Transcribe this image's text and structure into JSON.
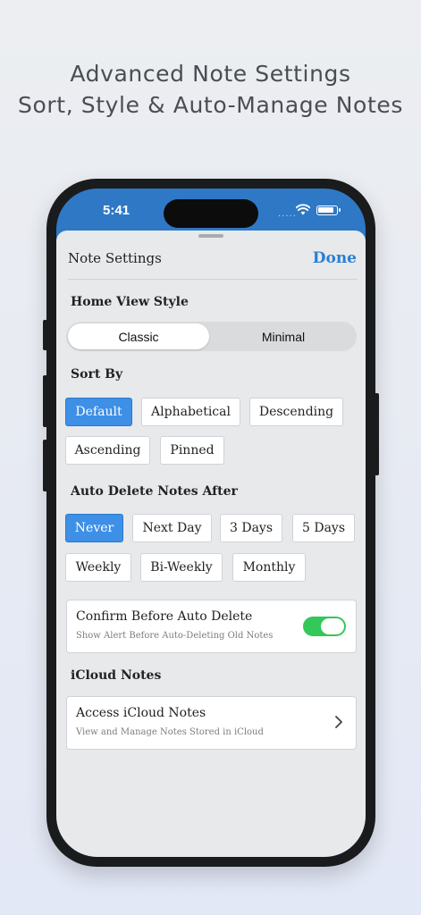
{
  "headline": {
    "line1": "Advanced Note Settings",
    "line2": "Sort, Style & Auto-Manage Notes"
  },
  "status_bar": {
    "time": "5:41",
    "signal_text": "....."
  },
  "sheet": {
    "title": "Note Settings",
    "done_label": "Done",
    "home_view": {
      "label": "Home View Style",
      "options": [
        "Classic",
        "Minimal"
      ],
      "selected": "Classic"
    },
    "sort_by": {
      "label": "Sort By",
      "options": [
        "Default",
        "Alphabetical",
        "Descending",
        "Ascending",
        "Pinned"
      ],
      "selected": "Default"
    },
    "auto_delete": {
      "label": "Auto Delete Notes After",
      "options": [
        "Never",
        "Next Day",
        "3 Days",
        "5 Days",
        "Weekly",
        "Bi-Weekly",
        "Monthly"
      ],
      "selected": "Never"
    },
    "confirm": {
      "title": "Confirm Before Auto Delete",
      "subtitle": "Show Alert Before Auto-Deleting Old Notes",
      "enabled": true
    },
    "icloud": {
      "section_label": "iCloud Notes",
      "title": "Access iCloud Notes",
      "subtitle": "View and Manage Notes Stored in iCloud"
    }
  },
  "colors": {
    "accent": "#2a7fd4",
    "selected_chip": "#3e8fe6",
    "toggle_on": "#34c759",
    "header_blue": "#2f78c5"
  }
}
